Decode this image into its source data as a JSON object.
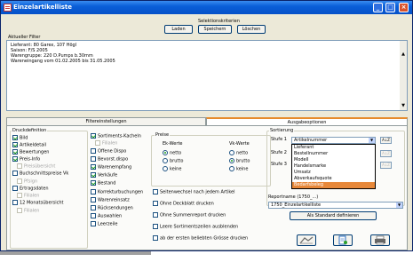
{
  "window": {
    "title": "Einzelartikelliste"
  },
  "selection": {
    "title": "Selektionskriterien",
    "buttons": [
      {
        "label": "Laden"
      },
      {
        "label": "Speichern"
      },
      {
        "label": "Löschen"
      }
    ]
  },
  "filter": {
    "label": "Aktueller Filter",
    "lines": [
      "Lieferant: 80 Garex, 107 Högl",
      "Saison: F/S 2005",
      "Warengruppe: 220 D.Pumps b.30mm",
      "Wareneingang vom 01.02.2005 bis 31.05.2005"
    ]
  },
  "tabs": [
    {
      "label": "Filtereinstellungen"
    },
    {
      "label": "Ausgabeoptionen"
    }
  ],
  "druck": {
    "label": "Druckdefinition",
    "items": [
      {
        "label": "Bild",
        "checked": true
      },
      {
        "label": "Artikeldetail",
        "checked": true
      },
      {
        "label": "Bewertungen",
        "checked": true
      },
      {
        "label": "Preis-Info",
        "checked": true
      },
      {
        "label": "Preisübersicht",
        "checked": false,
        "disabled": true
      },
      {
        "label": "Buchschnittspreise Vk",
        "checked": false
      },
      {
        "label": "Pfsign",
        "checked": false,
        "disabled": true
      },
      {
        "label": "Ertragsdaten",
        "checked": false
      },
      {
        "label": "Filialen",
        "checked": false,
        "disabled": true
      },
      {
        "label": "12 Monatsübersicht",
        "checked": false
      },
      {
        "label": "Filialen",
        "checked": false,
        "disabled": true
      }
    ]
  },
  "middle": {
    "items": [
      {
        "label": "Sortiments-Kacheln",
        "checked": true
      },
      {
        "label": "Filialen",
        "checked": false,
        "disabled": true
      },
      {
        "label": "Offene Dispo",
        "checked": false
      },
      {
        "label": "Bevorst.dispo",
        "checked": false
      },
      {
        "label": "Warenempfang",
        "checked": true
      },
      {
        "label": "Verkäufe",
        "checked": true
      },
      {
        "label": "Bestand",
        "checked": true
      },
      {
        "label": "Korrekturbuchungen",
        "checked": false
      },
      {
        "label": "Warenreinsatz",
        "checked": false
      },
      {
        "label": "Rücksendungen",
        "checked": false
      },
      {
        "label": "Auswahlen",
        "checked": false
      },
      {
        "label": "Leerzeile",
        "checked": false
      }
    ]
  },
  "preise": {
    "label": "Preise",
    "ek_label": "Ek-Werte",
    "vk_label": "Vk-Werte",
    "options": [
      "netto",
      "brutto",
      "keine"
    ],
    "ek_selected": 0,
    "vk_selected": 1
  },
  "options": [
    {
      "label": "Seitenwechsel nach jedem Artikel",
      "checked": false
    },
    {
      "label": "Ohne Deckblatt drucken",
      "checked": false
    },
    {
      "label": "Ohne Summenreport drucken",
      "checked": false
    },
    {
      "label": "Leere Sortimentszeilen ausblenden",
      "checked": false
    },
    {
      "label": "ab der ersten beliebten Grösse drucken",
      "checked": false
    }
  ],
  "sortierung": {
    "label": "Sortierung",
    "stufen": [
      "Stufe 1",
      "Stufe 2",
      "Stufe 3"
    ],
    "stufe1_value": "Artikelnummer",
    "dropdown": [
      "Lieferant",
      "Bestellnummer",
      "Modell",
      "Handelsmarke",
      "Umsatz",
      "Abverkaufsquote",
      "Bedarfsbeleg"
    ],
    "highlighted": 6
  },
  "report": {
    "label": "Reportname (1750_...)",
    "value": "1750_Einzelartikelliste",
    "std_button": "Als Standard definieren"
  },
  "icons": [
    "chart-icon",
    "report-icon",
    "print-icon"
  ]
}
